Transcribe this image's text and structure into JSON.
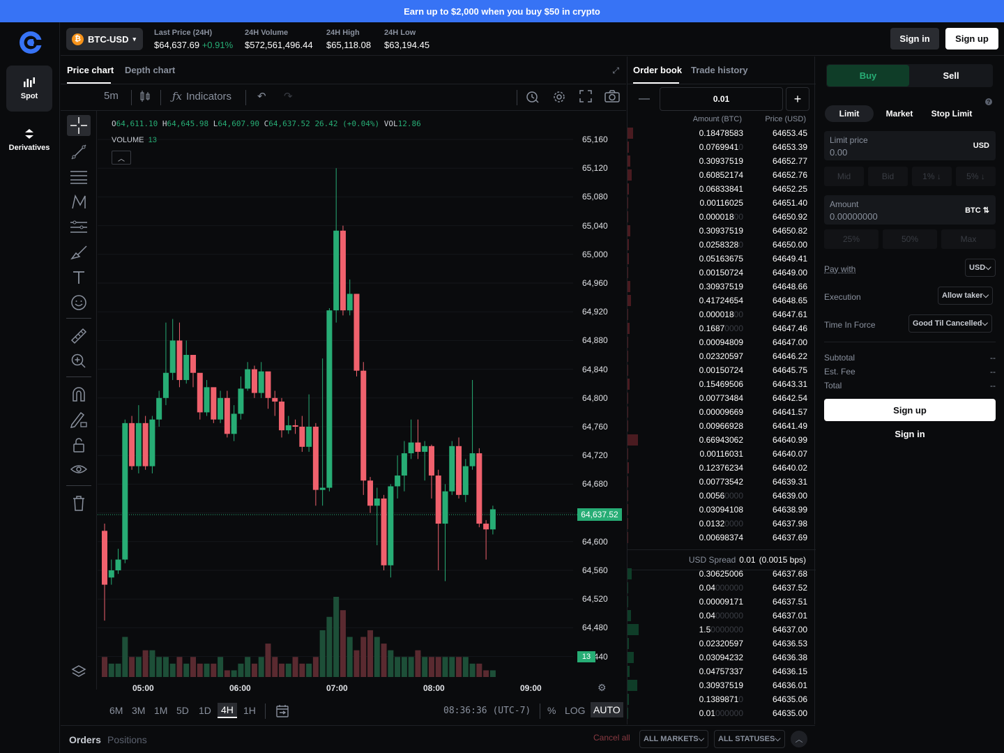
{
  "banner": {
    "text": "Earn up to $2,000 when you buy $50 in crypto"
  },
  "nav": {
    "spot": "Spot",
    "derivatives": "Derivatives"
  },
  "pair": {
    "coin_symbol": "₿",
    "label": "BTC-USD"
  },
  "stats": {
    "last_price_label": "Last Price (24H)",
    "last_price": "$64,637.69",
    "change": "+0.91%",
    "volume_label": "24H Volume",
    "volume": "$572,561,496.44",
    "high_label": "24H High",
    "high": "$65,118.08",
    "low_label": "24H Low",
    "low": "$63,194.45"
  },
  "auth": {
    "signin": "Sign in",
    "signup": "Sign up"
  },
  "chart_tabs": {
    "price": "Price chart",
    "depth": "Depth chart"
  },
  "toolbar": {
    "interval": "5m",
    "indicators": "Indicators"
  },
  "legend": {
    "o_label": "O",
    "o": "64,611.10",
    "h_label": "H",
    "h": "64,645.98",
    "l_label": "L",
    "l": "64,607.90",
    "c_label": "C",
    "c": "64,637.52",
    "chg": "26.42 (+0.04%)",
    "vol_label": "VOL",
    "vol": "12.86",
    "volume_label": "VOLUME",
    "volume": "13"
  },
  "colors": {
    "up": "#27ad75",
    "down": "#f0616d",
    "up_vol": "#1d4f38",
    "down_vol": "#5a2a30",
    "brand": "#3773f5"
  },
  "chart_data": {
    "type": "candlestick",
    "y_ticks": [
      "65,160",
      "65,120",
      "65,080",
      "65,040",
      "65,000",
      "64,960",
      "64,920",
      "64,880",
      "64,840",
      "64,800",
      "64,760",
      "64,720",
      "64,680",
      "64,600",
      "64,560",
      "64,520",
      "64,480",
      "64,440"
    ],
    "ylim": [
      64430,
      65180
    ],
    "x_ticks": [
      "05:00",
      "06:00",
      "07:00",
      "08:00",
      "09:00"
    ],
    "last_price_tag": "64,637.52",
    "volume_tag": "13",
    "candles": [
      [
        64615,
        64540,
        64625,
        64490
      ],
      [
        64550,
        64560,
        64575,
        64540
      ],
      [
        64560,
        64575,
        64590,
        64555
      ],
      [
        64575,
        64765,
        64770,
        64570
      ],
      [
        64765,
        64705,
        64775,
        64700
      ],
      [
        64705,
        64765,
        64790,
        64695
      ],
      [
        64765,
        64705,
        64775,
        64700
      ],
      [
        64705,
        64770,
        64775,
        64695
      ],
      [
        64770,
        64800,
        64810,
        64760
      ],
      [
        64800,
        64835,
        64905,
        64790
      ],
      [
        64835,
        64880,
        64910,
        64825
      ],
      [
        64880,
        64825,
        64905,
        64815
      ],
      [
        64825,
        64860,
        64880,
        64820
      ],
      [
        64860,
        64835,
        64855,
        64815
      ],
      [
        64835,
        64780,
        64830,
        64770
      ],
      [
        64780,
        64815,
        64825,
        64775
      ],
      [
        64815,
        64770,
        64805,
        64765
      ],
      [
        64770,
        64800,
        64810,
        64765
      ],
      [
        64800,
        64750,
        64810,
        64745
      ],
      [
        64750,
        64778,
        64790,
        64740
      ],
      [
        64778,
        64813,
        64830,
        64770
      ],
      [
        64813,
        64840,
        64850,
        64810
      ],
      [
        64840,
        64807,
        64845,
        64800
      ],
      [
        64807,
        64837,
        64850,
        64800
      ],
      [
        64837,
        64800,
        64830,
        64785
      ],
      [
        64800,
        64795,
        64810,
        64775
      ],
      [
        64795,
        64755,
        64800,
        64745
      ],
      [
        64755,
        64762,
        64775,
        64750
      ],
      [
        64762,
        64760,
        64770,
        64750
      ],
      [
        64760,
        64732,
        64775,
        64725
      ],
      [
        64732,
        64760,
        64805,
        64725
      ],
      [
        64760,
        64672,
        64765,
        64650
      ],
      [
        64672,
        64675,
        64855,
        64650
      ],
      [
        64675,
        64922,
        64925,
        64670
      ],
      [
        64922,
        65033,
        65120,
        64905
      ],
      [
        65033,
        64922,
        65040,
        64915
      ],
      [
        64922,
        64945,
        64965,
        64915
      ],
      [
        64945,
        64838,
        64945,
        64830
      ],
      [
        64838,
        64685,
        64850,
        64665
      ],
      [
        64685,
        64650,
        64690,
        64640
      ],
      [
        64650,
        64660,
        64675,
        64595
      ],
      [
        64660,
        64567,
        64665,
        64560
      ],
      [
        64567,
        64677,
        64680,
        64550
      ],
      [
        64677,
        64692,
        64720,
        64660
      ],
      [
        64692,
        64723,
        64740,
        64670
      ],
      [
        64723,
        64738,
        64770,
        64715
      ],
      [
        64738,
        64725,
        64770,
        64715
      ],
      [
        64725,
        64733,
        64740,
        64685
      ],
      [
        64733,
        64692,
        64735,
        64660
      ],
      [
        64692,
        64625,
        64700,
        64560
      ],
      [
        64625,
        64670,
        64680,
        64545
      ],
      [
        64670,
        64733,
        64740,
        64665
      ],
      [
        64733,
        64665,
        64745,
        64660
      ],
      [
        64665,
        64705,
        64715,
        64655
      ],
      [
        64705,
        64723,
        64825,
        64700
      ],
      [
        64723,
        64625,
        64730,
        64620
      ],
      [
        64625,
        64617,
        64630,
        64575
      ],
      [
        64617,
        64645,
        64650,
        64610
      ]
    ],
    "volumes": [
      3,
      2,
      2,
      6,
      3,
      3,
      4,
      4,
      3,
      3,
      2,
      3,
      2,
      3,
      2,
      2,
      2,
      3,
      1,
      1,
      2,
      3,
      2,
      3,
      5,
      3,
      2,
      2,
      3,
      2,
      2,
      3,
      7,
      9,
      12,
      10,
      6,
      4,
      6,
      7,
      6,
      5,
      4,
      3,
      3,
      3,
      4,
      3,
      3,
      3,
      3,
      3,
      3,
      3,
      2,
      2,
      1,
      1
    ]
  },
  "timeframes": [
    "6M",
    "3M",
    "1M",
    "5D",
    "1D",
    "4H",
    "1H"
  ],
  "active_timeframe": "4H",
  "clock": "08:36:36 (UTC-7)",
  "scale": {
    "percent": "%",
    "log": "LOG",
    "auto": "AUTO"
  },
  "orders_bar": {
    "orders": "Orders",
    "positions": "Positions",
    "cancel_all": "Cancel all",
    "all_markets": "ALL MARKETS",
    "all_statuses": "ALL STATUSES"
  },
  "orderbook": {
    "tab_book": "Order book",
    "tab_history": "Trade history",
    "minus": "—",
    "plus": "+",
    "step": "0.01",
    "amount_header": "Amount (BTC)",
    "price_header": "Price (USD)",
    "spread_label": "USD Spread",
    "spread_value": "0.01",
    "spread_bps": "(0.0015 bps)",
    "asks": [
      {
        "amt": "0.18478583",
        "dim": "",
        "price": "64653.45",
        "bar": 8
      },
      {
        "amt": "0.0769941",
        "dim": "0",
        "price": "64653.39",
        "bar": 2
      },
      {
        "amt": "0.30937519",
        "dim": "",
        "price": "64652.77",
        "bar": 4
      },
      {
        "amt": "0.60852174",
        "dim": "",
        "price": "64652.76",
        "bar": 6
      },
      {
        "amt": "0.06833841",
        "dim": "",
        "price": "64652.25",
        "bar": 2
      },
      {
        "amt": "0.00116025",
        "dim": "",
        "price": "64651.40",
        "bar": 1
      },
      {
        "amt": "0.000018",
        "dim": "00",
        "price": "64650.92",
        "bar": 1
      },
      {
        "amt": "0.30937519",
        "dim": "",
        "price": "64650.82",
        "bar": 4
      },
      {
        "amt": "0.0258328",
        "dim": "0",
        "price": "64650.00",
        "bar": 2
      },
      {
        "amt": "0.05163675",
        "dim": "",
        "price": "64649.41",
        "bar": 2
      },
      {
        "amt": "0.00150724",
        "dim": "",
        "price": "64649.00",
        "bar": 1
      },
      {
        "amt": "0.30937519",
        "dim": "",
        "price": "64648.66",
        "bar": 4
      },
      {
        "amt": "0.41724654",
        "dim": "",
        "price": "64648.65",
        "bar": 5
      },
      {
        "amt": "0.000018",
        "dim": "00",
        "price": "64647.61",
        "bar": 1
      },
      {
        "amt": "0.1687",
        "dim": "0000",
        "price": "64647.46",
        "bar": 3
      },
      {
        "amt": "0.00094809",
        "dim": "",
        "price": "64647.00",
        "bar": 1
      },
      {
        "amt": "0.02320597",
        "dim": "",
        "price": "64646.22",
        "bar": 1
      },
      {
        "amt": "0.00150724",
        "dim": "",
        "price": "64645.75",
        "bar": 1
      },
      {
        "amt": "0.15469506",
        "dim": "",
        "price": "64643.31",
        "bar": 3
      },
      {
        "amt": "0.00773484",
        "dim": "",
        "price": "64642.54",
        "bar": 1
      },
      {
        "amt": "0.00009669",
        "dim": "",
        "price": "64641.57",
        "bar": 1
      },
      {
        "amt": "0.00966928",
        "dim": "",
        "price": "64641.49",
        "bar": 1
      },
      {
        "amt": "0.66943062",
        "dim": "",
        "price": "64640.99",
        "bar": 15
      },
      {
        "amt": "0.00116031",
        "dim": "",
        "price": "64640.07",
        "bar": 1
      },
      {
        "amt": "0.12376234",
        "dim": "",
        "price": "64640.02",
        "bar": 2
      },
      {
        "amt": "0.00773542",
        "dim": "",
        "price": "64639.31",
        "bar": 1
      },
      {
        "amt": "0.0056",
        "dim": "0000",
        "price": "64639.00",
        "bar": 1
      },
      {
        "amt": "0.03094108",
        "dim": "",
        "price": "64638.99",
        "bar": 1
      },
      {
        "amt": "0.0132",
        "dim": "0000",
        "price": "64637.98",
        "bar": 1
      },
      {
        "amt": "0.00698374",
        "dim": "",
        "price": "64637.69",
        "bar": 1
      }
    ],
    "bids": [
      {
        "amt": "0.30625006",
        "dim": "",
        "price": "64637.68",
        "bar": 6
      },
      {
        "amt": "0.04",
        "dim": "000000",
        "price": "64637.52",
        "bar": 1
      },
      {
        "amt": "0.00009171",
        "dim": "",
        "price": "64637.51",
        "bar": 1
      },
      {
        "amt": "0.04",
        "dim": "000000",
        "price": "64637.01",
        "bar": 5
      },
      {
        "amt": "1.5",
        "dim": "0000000",
        "price": "64637.00",
        "bar": 16
      },
      {
        "amt": "0.02320597",
        "dim": "",
        "price": "64636.53",
        "bar": 2
      },
      {
        "amt": "0.03094232",
        "dim": "",
        "price": "64636.38",
        "bar": 9
      },
      {
        "amt": "0.04757337",
        "dim": "",
        "price": "64636.15",
        "bar": 3
      },
      {
        "amt": "0.30937519",
        "dim": "",
        "price": "64636.01",
        "bar": 14
      },
      {
        "amt": "0.1389871",
        "dim": "0",
        "price": "64635.06",
        "bar": 2
      },
      {
        "amt": "0.01",
        "dim": "000000",
        "price": "64635.00",
        "bar": 1
      }
    ]
  },
  "trade": {
    "buy": "Buy",
    "sell": "Sell",
    "limit": "Limit",
    "market": "Market",
    "stop_limit": "Stop Limit",
    "limit_price_label": "Limit price",
    "limit_price_value": "0.00",
    "limit_unit": "USD",
    "price_chips": [
      "Mid",
      "Bid",
      "1% ↓",
      "5% ↓"
    ],
    "amount_label": "Amount",
    "amount_value": "0.00000000",
    "amount_unit": "BTC ⇅",
    "amount_chips": [
      "25%",
      "50%",
      "Max"
    ],
    "pay_with_label": "Pay with",
    "pay_with_value": "USD",
    "execution_label": "Execution",
    "execution_value": "Allow taker",
    "tif_label": "Time In Force",
    "tif_value": "Good Til Cancelled",
    "subtotal_label": "Subtotal",
    "subtotal_value": "--",
    "fee_label": "Est. Fee",
    "fee_value": "--",
    "total_label": "Total",
    "total_value": "--",
    "signup": "Sign up",
    "signin": "Sign in"
  }
}
